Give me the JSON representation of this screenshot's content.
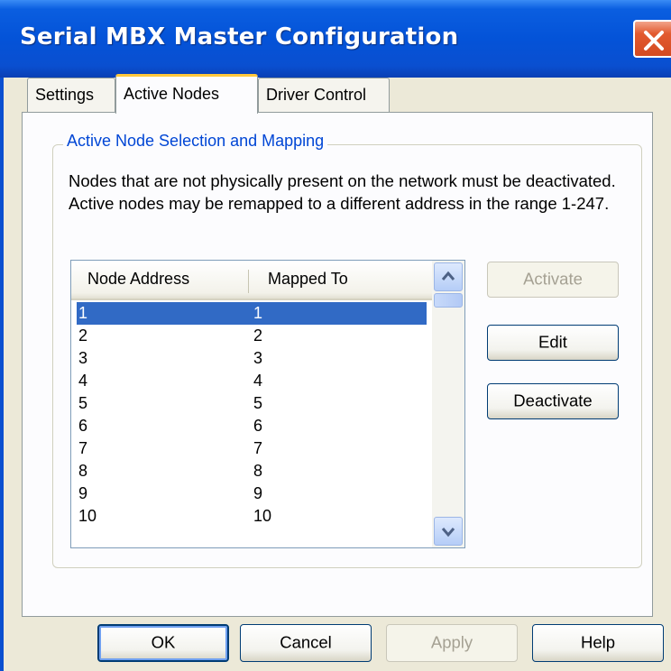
{
  "window": {
    "title": "Serial MBX Master Configuration"
  },
  "tabs": [
    {
      "label": "Settings",
      "active": false
    },
    {
      "label": "Active Nodes",
      "active": true
    },
    {
      "label": "Driver Control",
      "active": false
    }
  ],
  "group": {
    "title": "Active Node Selection and Mapping",
    "description": "Nodes that are not physically present on the network must be deactivated. Active nodes may be remapped to a different address in the range 1-247."
  },
  "node_list": {
    "columns": [
      "Node Address",
      "Mapped To"
    ],
    "rows": [
      {
        "address": "1",
        "mapped": "1",
        "selected": true
      },
      {
        "address": "2",
        "mapped": "2"
      },
      {
        "address": "3",
        "mapped": "3"
      },
      {
        "address": "4",
        "mapped": "4"
      },
      {
        "address": "5",
        "mapped": "5"
      },
      {
        "address": "6",
        "mapped": "6"
      },
      {
        "address": "7",
        "mapped": "7"
      },
      {
        "address": "8",
        "mapped": "8"
      },
      {
        "address": "9",
        "mapped": "9"
      },
      {
        "address": "10",
        "mapped": "10"
      }
    ]
  },
  "side_buttons": {
    "activate": "Activate",
    "edit": "Edit",
    "deactivate": "Deactivate"
  },
  "footer_buttons": {
    "ok": "OK",
    "cancel": "Cancel",
    "apply": "Apply",
    "help": "Help"
  },
  "icons": {
    "close": "close-icon",
    "scroll_up": "chevron-up-icon",
    "scroll_down": "chevron-down-icon"
  },
  "colors": {
    "title_bar": "#0453d8",
    "selection": "#316ac5",
    "group_title": "#0046d5",
    "tab_highlight": "#ffc83c"
  }
}
